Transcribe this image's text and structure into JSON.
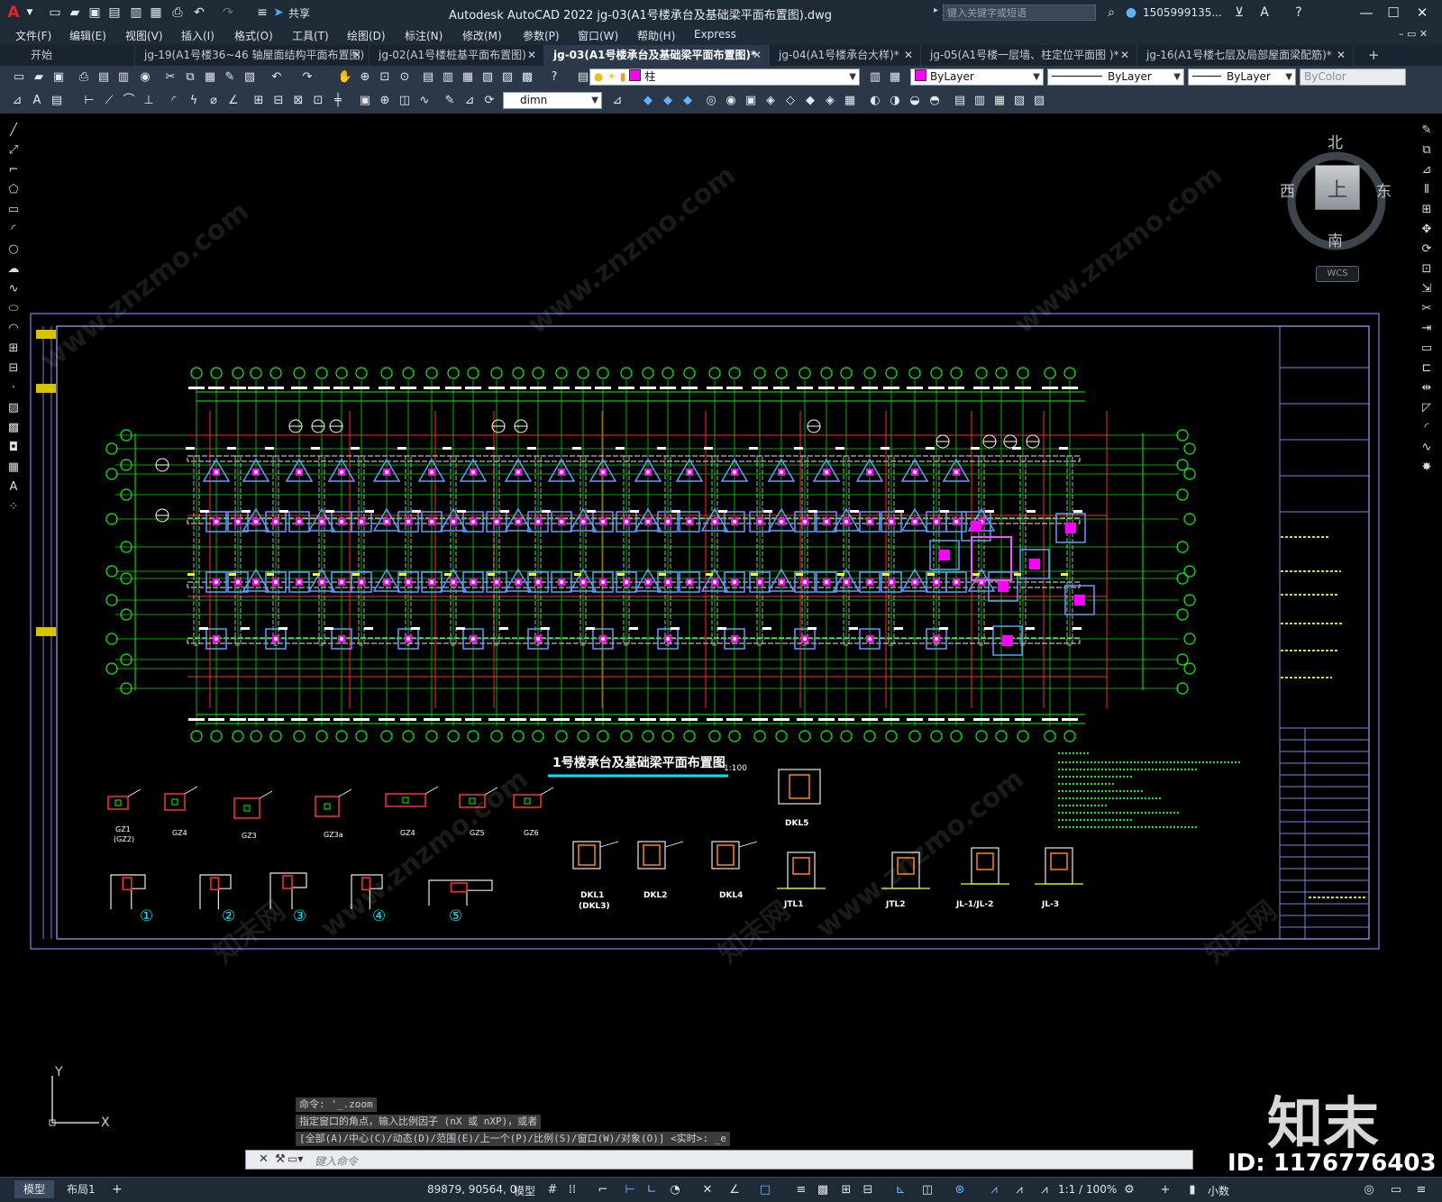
{
  "window": {
    "title": "Autodesk AutoCAD 2022    jg-03(A1号楼承台及基础梁平面布置图).dwg",
    "share_label": "共享",
    "search_placeholder": "键入关键字或短语",
    "user": "1505999135...",
    "app_letter": "A"
  },
  "menus": [
    "文件(F)",
    "编辑(E)",
    "视图(V)",
    "插入(I)",
    "格式(O)",
    "工具(T)",
    "绘图(D)",
    "标注(N)",
    "修改(M)",
    "参数(P)",
    "窗口(W)",
    "帮助(H)",
    "Express"
  ],
  "tabs": [
    {
      "label": "开始",
      "active": false
    },
    {
      "label": "jg-19(A1号楼36~46 轴屋面结构平面布置图)",
      "active": false
    },
    {
      "label": "jg-02(A1号楼桩基平面布置图)",
      "active": false
    },
    {
      "label": "jg-03(A1号楼承台及基础梁平面布置图)*",
      "active": true
    },
    {
      "label": "jg-04(A1号楼承台大样)*",
      "active": false
    },
    {
      "label": "jg-05(A1号楼一层墙、柱定位平面图 )*",
      "active": false
    },
    {
      "label": "jg-16(A1号楼七层及局部屋面梁配筋)*",
      "active": false
    }
  ],
  "toolbar": {
    "layer": "柱",
    "layer_color": "#ff00ff",
    "color_combo": "ByLayer",
    "linetype_combo": "ByLayer",
    "lineweight_combo": "ByLayer",
    "plotstyle_combo": "ByColor",
    "dimstyle_combo": "dimn"
  },
  "viewcube": {
    "north": "北",
    "south": "南",
    "east": "东",
    "west": "西",
    "face": "上",
    "wcs": "WCS"
  },
  "drawing": {
    "plan_title": "1号楼承台及基础梁平面布置图",
    "plan_scale": "1:100",
    "details_top": [
      "GZ1",
      "(GZ2)",
      "GZ4",
      "GZ3",
      "GZ3a",
      "GZ4",
      "GZ5",
      "GZ6"
    ],
    "dkl5": "DKL5",
    "details_bottom": [
      "DKL1",
      "(DKL3)",
      "DKL2",
      "DKL4",
      "JTL1",
      "JTL2",
      "JL-1/JL-2",
      "JL-3"
    ],
    "circle_labels": [
      "①",
      "②",
      "③",
      "④",
      "⑤"
    ]
  },
  "command": {
    "history": [
      "命令: '_.zoom",
      "指定窗口的角点，输入比例因子 (nX 或 nXP)，或者",
      "[全部(A)/中心(C)/动态(D)/范围(E)/上一个(P)/比例(S)/窗口(W)/对象(O)] <实时>: _e"
    ],
    "placeholder": "键入命令"
  },
  "status": {
    "model_tab": "模型",
    "layout_tab": "布局1",
    "coords": "89879, 90564, 0",
    "space": "模型",
    "scale": "1:1 / 100%",
    "units": "小数"
  },
  "watermark": {
    "brand": "知末",
    "id": "ID: 1176776403",
    "site": "www.znzmo.com",
    "site_cn": "知末网"
  }
}
